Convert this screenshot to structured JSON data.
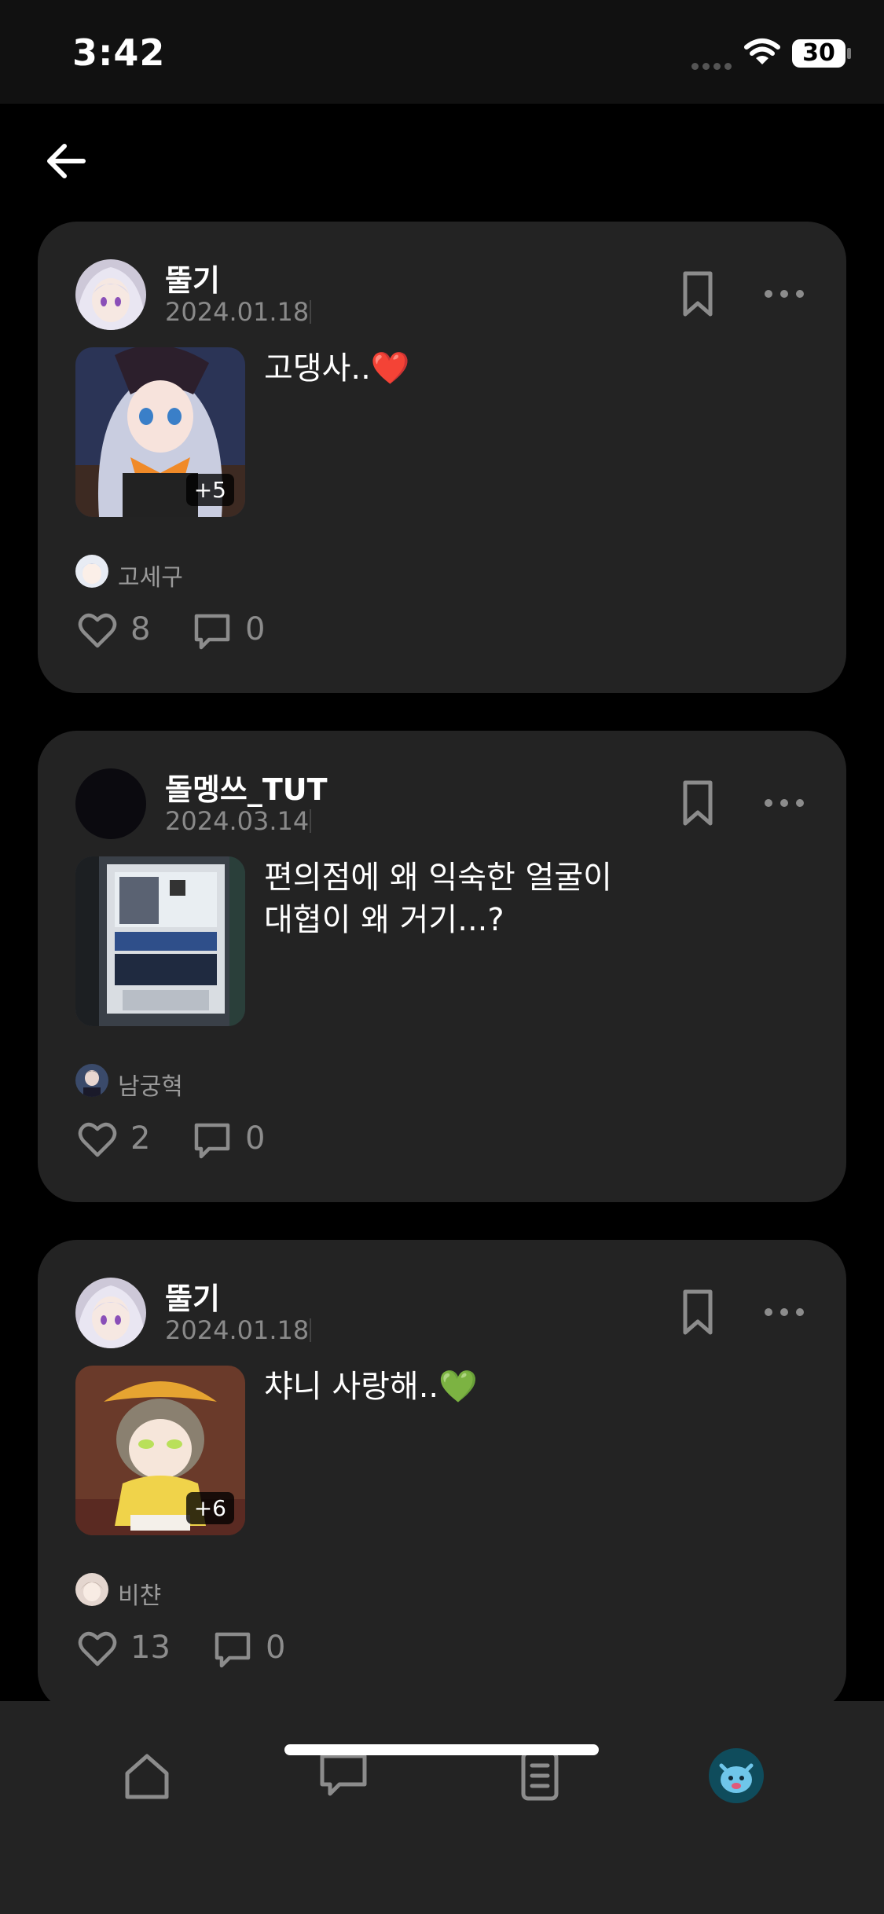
{
  "status_bar": {
    "time": "3:42",
    "battery": "30"
  },
  "posts": [
    {
      "author": "뚤기",
      "date": "2024.01.18",
      "text": "고댕사..❤️",
      "image_extra": "+5",
      "tag": "고세구",
      "likes": "8",
      "comments": "0"
    },
    {
      "author": "돌멩쓰_TUT",
      "date": "2024.03.14",
      "text": "편의점에 왜 익숙한 얼굴이\n대협이 왜 거기...?",
      "image_extra": "",
      "tag": "남궁혁",
      "likes": "2",
      "comments": "0"
    },
    {
      "author": "뚤기",
      "date": "2024.01.18",
      "text": "챠니 사랑해..💚",
      "image_extra": "+6",
      "tag": "비챤",
      "likes": "13",
      "comments": "0"
    }
  ],
  "icons": {
    "back": "arrow-left-icon",
    "bookmark": "bookmark-icon",
    "more": "more-horizontal-icon",
    "like": "heart-icon",
    "comment": "comment-icon",
    "tabs": [
      "home-icon",
      "chat-icon",
      "document-icon",
      "profile-avatar"
    ]
  },
  "colors": {
    "background": "#000000",
    "card": "#232323",
    "muted_text": "#8a8a8a"
  }
}
